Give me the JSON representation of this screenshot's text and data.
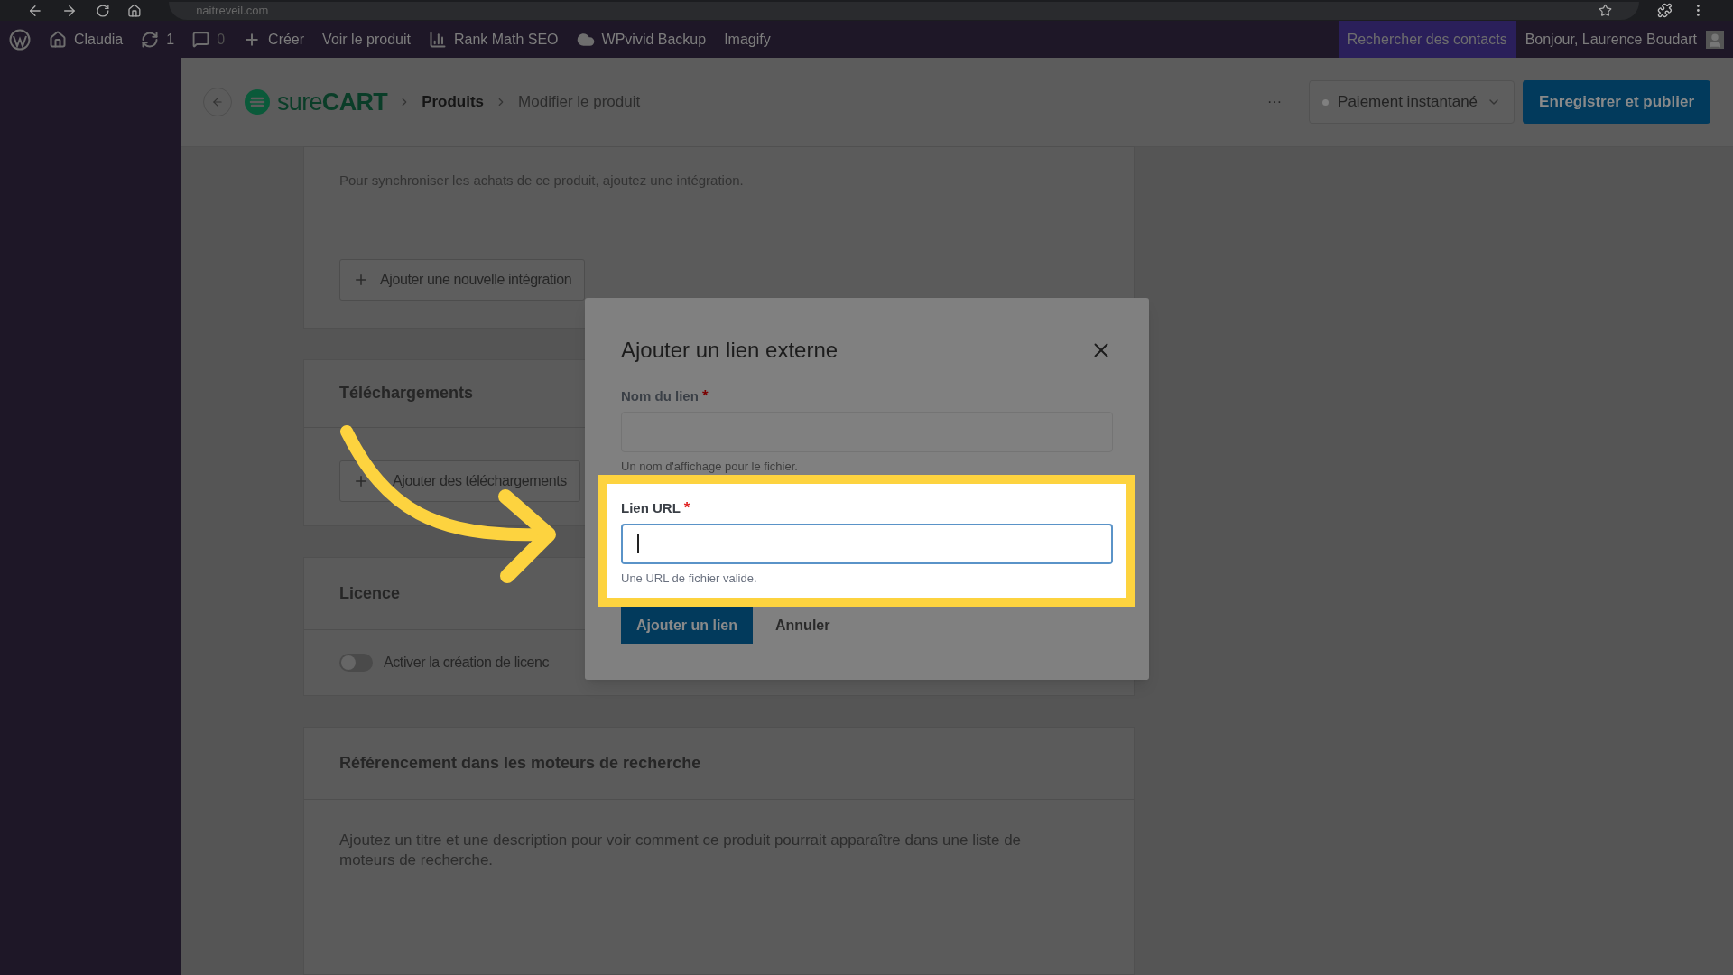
{
  "browser": {
    "url": "naitreveil.com"
  },
  "admin_bar": {
    "items": [
      {
        "kind": "wordpress"
      },
      {
        "kind": "home",
        "label": "Claudia"
      },
      {
        "kind": "refresh",
        "label": "1"
      },
      {
        "kind": "comment",
        "label": "0"
      },
      {
        "kind": "plus",
        "label": "Créer"
      },
      {
        "kind": "text",
        "label": "Voir le produit"
      },
      {
        "kind": "chart",
        "label": "Rank Math SEO"
      },
      {
        "kind": "cloud",
        "label": "WPvivid Backup"
      },
      {
        "kind": "text",
        "label": "Imagify"
      }
    ],
    "search_contacts": "Rechercher des contacts",
    "greeting": "Bonjour, Laurence Boudart"
  },
  "header": {
    "logo": "sure**CART**",
    "breadcrumbs": [
      {
        "label": "Produits",
        "current": false
      },
      {
        "label": "Modifier le produit",
        "current": true
      }
    ],
    "more": "···",
    "mode_select": "Paiement instantané",
    "publish_button": "Enregistrer et publier"
  },
  "sections": [
    {
      "kind": "integrations",
      "text": "Pour synchroniser les achats de ce produit, ajoutez une intégration.",
      "button": "Ajouter une nouvelle intégration"
    },
    {
      "kind": "downloads",
      "title": "Téléchargements",
      "button": "Ajouter des téléchargements"
    },
    {
      "kind": "licence",
      "title": "Licence",
      "toggle": {
        "label": "Activer la création de licenc",
        "on": false
      }
    },
    {
      "kind": "seo",
      "title": "Référencement dans les moteurs de recherche",
      "text": "Ajoutez un titre et une description pour voir comment ce produit pourrait apparaître dans une liste de moteurs de recherche."
    }
  ],
  "modal": {
    "title": "Ajouter un lien externe",
    "fields": [
      {
        "label": "Nom du lien",
        "required_mark": "*",
        "hint": "Un nom d'affichage pour le fichier.",
        "focused": false,
        "highlighted": false
      },
      {
        "label": "Lien URL",
        "required_mark": "*",
        "hint": "Une URL de fichier valide.",
        "focused": true,
        "highlighted": true
      }
    ],
    "submit_button": "Ajouter un lien",
    "cancel_button": "Annuler"
  }
}
